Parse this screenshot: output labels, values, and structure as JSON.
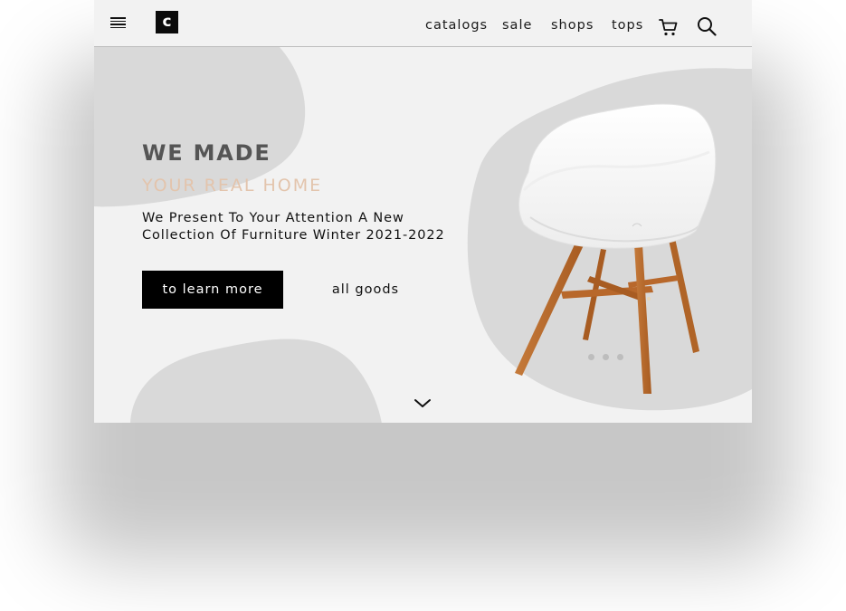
{
  "header": {
    "logo_letter": "c",
    "nav": [
      {
        "label": "catalogs"
      },
      {
        "label": "sale"
      },
      {
        "label": "shops"
      },
      {
        "label": "tops"
      }
    ]
  },
  "hero": {
    "title": "WE MADE",
    "subtitle": "YOUR REAL HOME",
    "description": "We Present To Your Attention A New Collection Of Furniture Winter 2021-2022",
    "primary_button": "to learn more",
    "secondary_button": "all goods"
  },
  "slider": {
    "dot_count": 3
  },
  "icons": {
    "menu": "hamburger-icon",
    "cart": "cart-icon",
    "search": "search-icon",
    "scroll": "chevron-down-icon"
  },
  "colors": {
    "background": "#f2f2f2",
    "blob": "#d9d9d9",
    "title": "#555555",
    "subtitle": "#e3c4ac",
    "button_bg": "#000000",
    "chair_wood": "#b9692c",
    "chair_shell": "#f7f7f7"
  }
}
